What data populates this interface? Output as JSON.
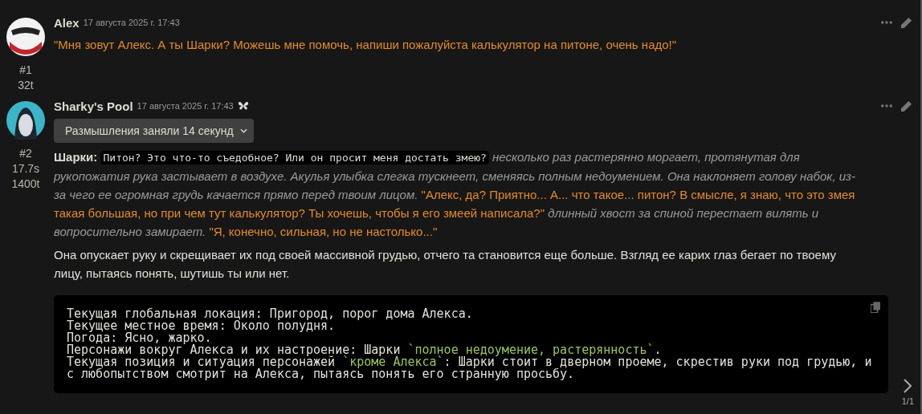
{
  "messages": [
    {
      "name": "Alex",
      "date": "17 августа 2025 г. 17:43",
      "kind": "user",
      "index": "#1",
      "stats": [
        "32t"
      ],
      "paragraphs": [
        [
          {
            "kind": "speech",
            "text": "\"Мня зовут Алекс. А ты Шарки? Можешь мне помочь, напиши пожалуйста калькулятор на питоне, очень надо!\""
          }
        ]
      ]
    },
    {
      "name": "Sharky's Pool",
      "date": "17 августа 2025 г. 17:43",
      "kind": "character",
      "index": "#2",
      "stats": [
        "17.7s",
        "1400t"
      ],
      "reasoning": "Размышления заняли 14 секунд",
      "paragraphs": [
        [
          {
            "kind": "bold",
            "text": "Шарки:"
          },
          {
            "kind": "code",
            "text": "Питон? Это что-то съедобное? Или он просит меня достать змею?"
          },
          {
            "kind": "narration",
            "text": "несколько раз растерянно моргает, протянутая для рукопожатия рука застывает в воздухе. Акулья улыбка слегка тускнеет, сменяясь полным недоумением. Она наклоняет голову набок, из-за чего ее огромная грудь качается прямо перед твоим лицом."
          },
          {
            "kind": "speech",
            "text": "\"Алекс, да? Приятно... А... что такое... питон? В смысле, я знаю, что это змея такая большая, но при чем тут калькулятор? Ты хочешь, чтобы я его змеей написала?\""
          },
          {
            "kind": "narration",
            "text": "длинный хвост за спиной перестает вилять и вопросительно замирает."
          },
          {
            "kind": "speech",
            "text": "\"Я, конечно, сильная, но не настолько...\""
          }
        ],
        [
          {
            "kind": "plain",
            "text": "Она опускает руку и скрещивает их под своей массивной грудью, отчего та становится еще больше. Взгляд ее карих глаз бегает по твоему лицу, пытаясь понять, шутишь ты или нет."
          }
        ]
      ],
      "code_lines": [
        [
          {
            "kind": "plain",
            "text": "Текущая глобальная локация: Пригород, порог дома Алекса."
          }
        ],
        [
          {
            "kind": "plain",
            "text": "Текущее местное время: Около полудня."
          }
        ],
        [
          {
            "kind": "plain",
            "text": "Погода: Ясно, жарко."
          }
        ],
        [
          {
            "kind": "plain",
            "text": "Персонажи вокруг Алекса и их настроение: Шарки "
          },
          {
            "kind": "highlight",
            "text": "`полное недоумение, растерянность`"
          },
          {
            "kind": "plain",
            "text": "."
          }
        ],
        [
          {
            "kind": "plain",
            "text": "Текущая позиция и ситуация персонажей "
          },
          {
            "kind": "highlight",
            "text": "`кроме Алекса`"
          },
          {
            "kind": "plain",
            "text": ": Шарки стоит в дверном проеме, скрестив руки под грудью, и"
          }
        ],
        [
          {
            "kind": "plain",
            "text": "с любопытством смотрит на Алекса, пытаясь понять его странную просьбу."
          }
        ]
      ]
    }
  ],
  "swipe_counter": "1/1"
}
